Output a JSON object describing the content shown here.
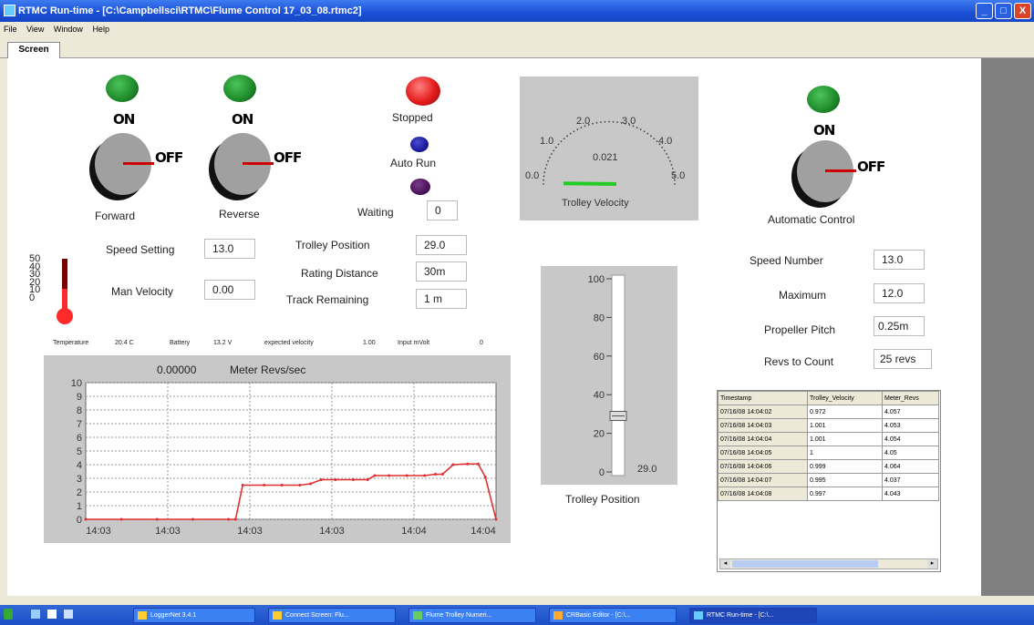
{
  "window": {
    "title": "RTMC Run-time - [C:\\Campbellsci\\RTMC\\Flume Control 17_03_08.rtmc2]",
    "minimize": "_",
    "maximize": "□",
    "close": "X"
  },
  "menu": [
    "File",
    "View",
    "Window",
    "Help"
  ],
  "tabs": [
    "Screen"
  ],
  "switches": {
    "on_text": "ON",
    "off_text": "OFF",
    "forward": {
      "label": "Forward"
    },
    "reverse": {
      "label": "Reverse"
    },
    "automatic": {
      "label": "Automatic Control"
    }
  },
  "status": {
    "stopped": "Stopped",
    "auto_run": "Auto Run",
    "waiting_label": "Waiting",
    "waiting_value": "0"
  },
  "fields": {
    "speed_setting": {
      "label": "Speed Setting",
      "value": "13.0"
    },
    "man_velocity": {
      "label": "Man Velocity",
      "value": "0.00"
    },
    "trolley_position": {
      "label": "Trolley Position",
      "value": "29.0"
    },
    "rating_distance": {
      "label": "Rating Distance",
      "value": "30m"
    },
    "track_remaining": {
      "label": "Track Remaining",
      "value": "1 m"
    },
    "speed_number": {
      "label": "Speed Number",
      "value": "13.0"
    },
    "maximum": {
      "label": "Maximum",
      "value": "12.0"
    },
    "propeller_pitch": {
      "label": "Propeller Pitch",
      "value": "0.25m"
    },
    "revs_to_count": {
      "label": "Revs to Count",
      "value": "25 revs"
    }
  },
  "thermometer": {
    "ticks": [
      "50",
      "40",
      "30",
      "20",
      "10",
      "0"
    ],
    "level": 0.41
  },
  "readouts": {
    "temperature_label": "Temperature",
    "temperature_value": "20.4 C",
    "battery_label": "Battery",
    "battery_value": "13.2 V",
    "expected_velocity_label": "expected velocity",
    "expected_velocity_value": "1.00",
    "input_mvolt_label": "Input mVolt",
    "input_mvolt_value": "0"
  },
  "gauge": {
    "title": "Trolley Velocity",
    "value": "0.021",
    "ticks": [
      "0.0",
      "1.0",
      "2.0",
      "3.0",
      "4.0",
      "5.0"
    ],
    "min": 0,
    "max": 5,
    "reading": 0.021
  },
  "slider": {
    "caption": "Trolley Position",
    "value": "29.0",
    "ticks": [
      "100",
      "80",
      "60",
      "40",
      "20",
      "0"
    ],
    "min": 0,
    "max": 100,
    "reading": 29
  },
  "chart_data": {
    "type": "line",
    "title": "Meter Revs/sec",
    "current_value": "0.00000",
    "ylim": [
      0,
      10
    ],
    "yticks": [
      "10",
      "9",
      "8",
      "7",
      "6",
      "5",
      "4",
      "3",
      "2",
      "1",
      "0"
    ],
    "xticks": [
      "14:03",
      "14:03",
      "14:03",
      "14:03",
      "14:04",
      "14:04"
    ],
    "grid": true,
    "series": [
      {
        "color": "#e03030",
        "points": [
          [
            0,
            0
          ],
          [
            0.1,
            0
          ],
          [
            0.2,
            0
          ],
          [
            0.3,
            0
          ],
          [
            0.4,
            0
          ],
          [
            0.42,
            0
          ],
          [
            0.44,
            2.5
          ],
          [
            0.5,
            2.5
          ],
          [
            0.55,
            2.5
          ],
          [
            0.6,
            2.5
          ],
          [
            0.63,
            2.6
          ],
          [
            0.66,
            2.9
          ],
          [
            0.7,
            2.9
          ],
          [
            0.75,
            2.9
          ],
          [
            0.79,
            2.9
          ],
          [
            0.81,
            3.2
          ],
          [
            0.85,
            3.2
          ],
          [
            0.9,
            3.2
          ],
          [
            0.95,
            3.2
          ],
          [
            0.98,
            3.3
          ],
          [
            1.0,
            3.3
          ],
          [
            1.03,
            4.0
          ],
          [
            1.07,
            4.05
          ],
          [
            1.1,
            4.05
          ],
          [
            1.12,
            3.1
          ],
          [
            1.15,
            0
          ]
        ],
        "x_range": [
          0,
          1.15
        ]
      }
    ]
  },
  "table": {
    "headers": [
      "Timestamp",
      "Trolley_Velocity",
      "Meter_Revs"
    ],
    "rows": [
      [
        "07/16/08 14:04:02",
        "0.972",
        "4.057"
      ],
      [
        "07/16/08 14:04:03",
        "1.001",
        "4.053"
      ],
      [
        "07/16/08 14:04:04",
        "1.001",
        "4.054"
      ],
      [
        "07/16/08 14:04:05",
        "1",
        "4.05"
      ],
      [
        "07/16/08 14:04:06",
        "0.999",
        "4.064"
      ],
      [
        "07/16/08 14:04:07",
        "0.995",
        "4.037"
      ],
      [
        "07/16/08 14:04:08",
        "0.997",
        "4.043"
      ]
    ]
  },
  "taskbar": {
    "items": [
      "LoggerNet 3.4.1",
      "Connect Screen: Flu...",
      "Flume Trolley Numeri...",
      "CRBasic Editor - [C:\\...",
      "RTMC Run-time - [C:\\..."
    ]
  },
  "colors": {
    "led_green": "#1e8a2a",
    "led_red": "#e41b1b",
    "led_blue": "#1a1a9a",
    "led_purple": "#4a145a",
    "gauge_needle": "#22cc22"
  }
}
